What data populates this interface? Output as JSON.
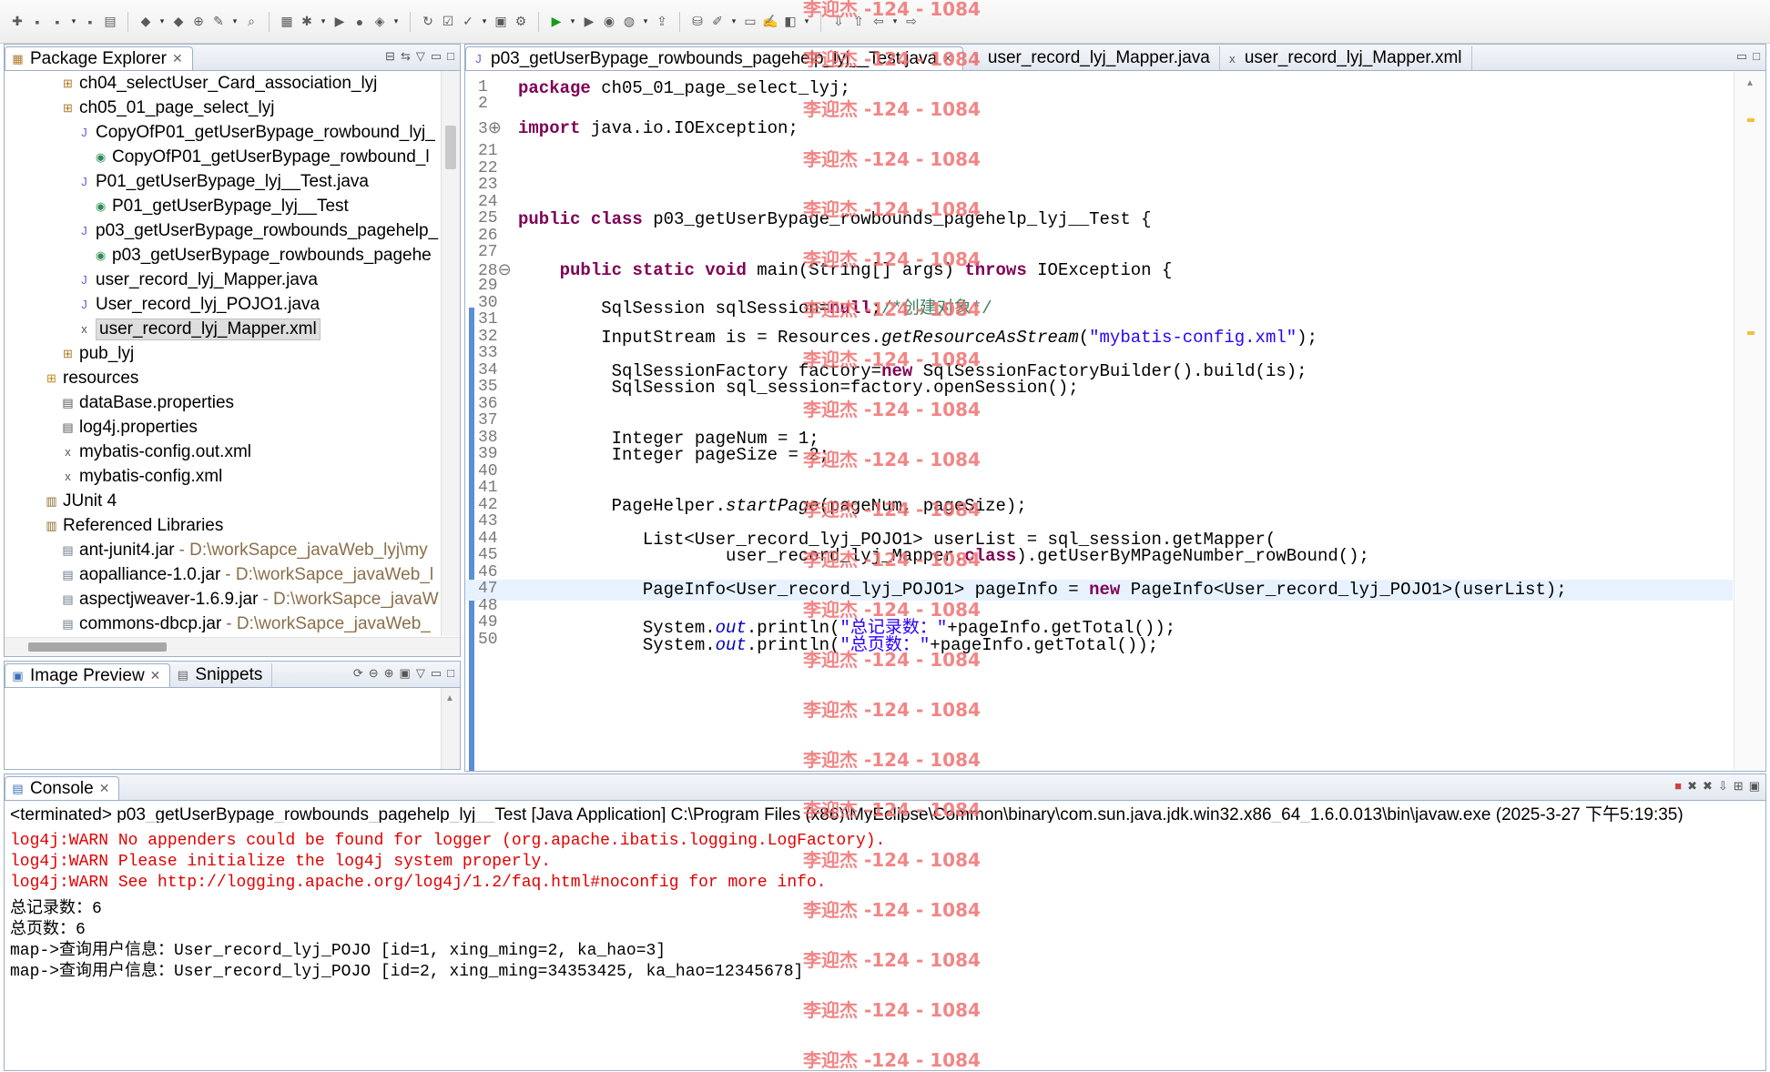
{
  "package_explorer": {
    "tab_label": "Package Explorer",
    "items": [
      {
        "label": "ch04_selectUser_Card_association_lyj",
        "icon": "package-icon"
      },
      {
        "label": "ch05_01_page_select_lyj",
        "icon": "package-icon"
      },
      {
        "label": "CopyOfP01_getUserBypage_rowbound_lyj_",
        "icon": "java-file-icon"
      },
      {
        "label": "CopyOfP01_getUserBypage_rowbound_l",
        "icon": "class-icon"
      },
      {
        "label": "P01_getUserBypage_lyj__Test.java",
        "icon": "java-file-icon"
      },
      {
        "label": "P01_getUserBypage_lyj__Test",
        "icon": "class-icon"
      },
      {
        "label": "p03_getUserBypage_rowbounds_pagehelp_",
        "icon": "java-file-icon"
      },
      {
        "label": "p03_getUserBypage_rowbounds_pagehe",
        "icon": "class-icon"
      },
      {
        "label": "user_record_lyj_Mapper.java",
        "icon": "java-file-icon"
      },
      {
        "label": "User_record_lyj_POJO1.java",
        "icon": "java-file-icon"
      },
      {
        "label": "user_record_lyj_Mapper.xml",
        "icon": "xml-file-icon"
      },
      {
        "label": "pub_lyj",
        "icon": "package-icon"
      },
      {
        "label": "resources",
        "icon": "source-folder-icon"
      },
      {
        "label": "dataBase.properties",
        "icon": "properties-file-icon"
      },
      {
        "label": "log4j.properties",
        "icon": "properties-file-icon"
      },
      {
        "label": "mybatis-config.out.xml",
        "icon": "xml-file-icon"
      },
      {
        "label": "mybatis-config.xml",
        "icon": "xml-file-icon"
      },
      {
        "label": "JUnit 4",
        "icon": "library-icon"
      },
      {
        "label": "Referenced Libraries",
        "icon": "library-icon"
      },
      {
        "label": "ant-junit4.jar",
        "path": " - D:\\workSapce_javaWeb_lyj\\my",
        "icon": "jar-icon"
      },
      {
        "label": "aopalliance-1.0.jar",
        "path": " - D:\\workSapce_javaWeb_l",
        "icon": "jar-icon"
      },
      {
        "label": "aspectjweaver-1.6.9.jar",
        "path": " - D:\\workSapce_javaW",
        "icon": "jar-icon"
      },
      {
        "label": "commons-dbcp.jar",
        "path": " - D:\\workSapce_javaWeb_",
        "icon": "jar-icon"
      }
    ]
  },
  "image_preview": {
    "tab_label": "Image Preview",
    "snippets_label": "Snippets"
  },
  "editor": {
    "tabs": [
      {
        "label": "p03_getUserBypage_rowbounds_pagehelp_lyj__Test.java",
        "active": true
      },
      {
        "label": "user_record_lyj_Mapper.java",
        "active": false
      },
      {
        "label": "user_record_lyj_Mapper.xml",
        "active": false
      }
    ],
    "lines": [
      {
        "n": "1",
        "t": "package ch05_01_page_select_lyj;"
      },
      {
        "n": "2",
        "t": ""
      },
      {
        "n": "3⊕",
        "t": "import java.io.IOException;"
      },
      {
        "n": "21",
        "t": ""
      },
      {
        "n": "22",
        "t": ""
      },
      {
        "n": "23",
        "t": ""
      },
      {
        "n": "24",
        "t": ""
      },
      {
        "n": "25",
        "t": "public class p03_getUserBypage_rowbounds_pagehelp_lyj__Test {"
      },
      {
        "n": "26",
        "t": ""
      },
      {
        "n": "27",
        "t": ""
      },
      {
        "n": "28⊖",
        "t": "    public static void main(String[] args) throws IOException {"
      },
      {
        "n": "29",
        "t": ""
      },
      {
        "n": "30",
        "t": "        SqlSession sqlSession=null;/*创建对象*/"
      },
      {
        "n": "31",
        "t": ""
      },
      {
        "n": "32",
        "t": "        InputStream is = Resources.getResourceAsStream(\"mybatis-config.xml\");"
      },
      {
        "n": "33",
        "t": ""
      },
      {
        "n": "34",
        "t": "         SqlSessionFactory factory=new SqlSessionFactoryBuilder().build(is);"
      },
      {
        "n": "35",
        "t": "         SqlSession sql_session=factory.openSession();"
      },
      {
        "n": "36",
        "t": ""
      },
      {
        "n": "37",
        "t": ""
      },
      {
        "n": "38",
        "t": "         Integer pageNum = 1;"
      },
      {
        "n": "39",
        "t": "         Integer pageSize = 2;"
      },
      {
        "n": "40",
        "t": ""
      },
      {
        "n": "41",
        "t": ""
      },
      {
        "n": "42",
        "t": "         PageHelper.startPage(pageNum, pageSize);"
      },
      {
        "n": "43",
        "t": ""
      },
      {
        "n": "44",
        "t": "            List<User_record_lyj_POJO1> userList = sql_session.getMapper("
      },
      {
        "n": "45",
        "t": "                    user_record_lyj_Mapper.class).getUserByMPageNumber_rowBound();"
      },
      {
        "n": "46",
        "t": ""
      },
      {
        "n": "47",
        "t": "            PageInfo<User_record_lyj_POJO1> pageInfo = new PageInfo<User_record_lyj_POJO1>(userList);"
      },
      {
        "n": "48",
        "t": ""
      },
      {
        "n": "49",
        "t": "            System.out.println(\"总记录数：\"+pageInfo.getTotal());"
      },
      {
        "n": "50",
        "t": "            System.out.println(\"总页数：\"+pageInfo.getTotal());"
      }
    ]
  },
  "console": {
    "tab_label": "Console",
    "header": "<terminated> p03_getUserBypage_rowbounds_pagehelp_lyj__Test [Java Application] C:\\Program Files (x86)\\MyEclipse\\Common\\binary\\com.sun.java.jdk.win32.x86_64_1.6.0.013\\bin\\javaw.exe (2025-3-27 下午5:19:35)",
    "lines": [
      {
        "t": "log4j:WARN No appenders could be found for logger (org.apache.ibatis.logging.LogFactory).",
        "red": true
      },
      {
        "t": "log4j:WARN Please initialize the log4j system properly.",
        "red": true
      },
      {
        "t": "log4j:WARN See http://logging.apache.org/log4j/1.2/faq.html#noconfig for more info.",
        "red": true
      },
      {
        "t": "总记录数：6",
        "red": false
      },
      {
        "t": "总页数：6",
        "red": false
      },
      {
        "t": "map->查询用户信息：User_record_lyj_POJO [id=1, xing_ming=2, ka_hao=3]",
        "red": false
      },
      {
        "t": "map->查询用户信息：User_record_lyj_POJO [id=2, xing_ming=34353425, ka_hao=12345678]",
        "red": false
      }
    ]
  },
  "watermark": "李迎杰 -124 - 1084",
  "colors": {
    "keyword": "#7f0055",
    "string": "#2a00ff",
    "comment": "#3f7f5f",
    "console_error": "#e00000"
  }
}
